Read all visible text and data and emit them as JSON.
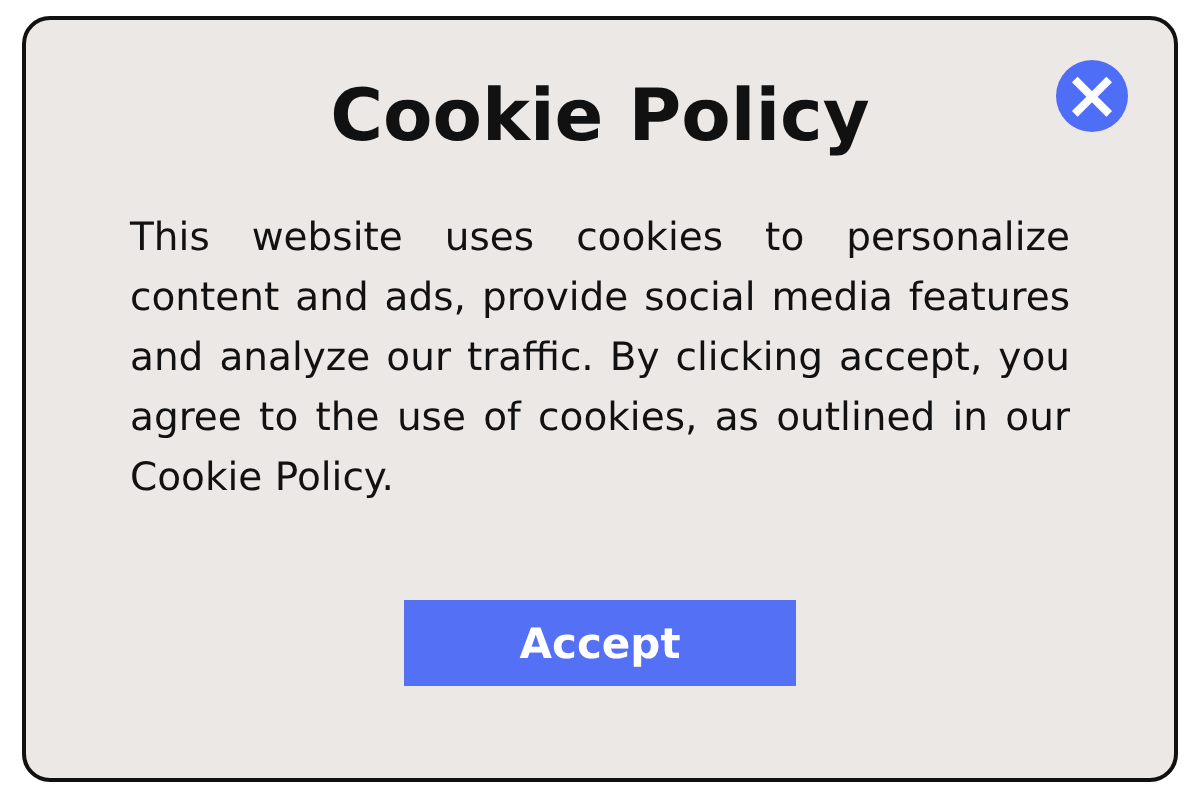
{
  "dialog": {
    "title": "Cookie Policy",
    "close_icon": "×",
    "message": "This website uses cookies to personalize content and ads, provide social media features and analyze our traffic. By clicking accept, you agree to the use of cookies, as outlined in our Cookie Policy.",
    "buttons": [
      "Accept"
    ]
  }
}
